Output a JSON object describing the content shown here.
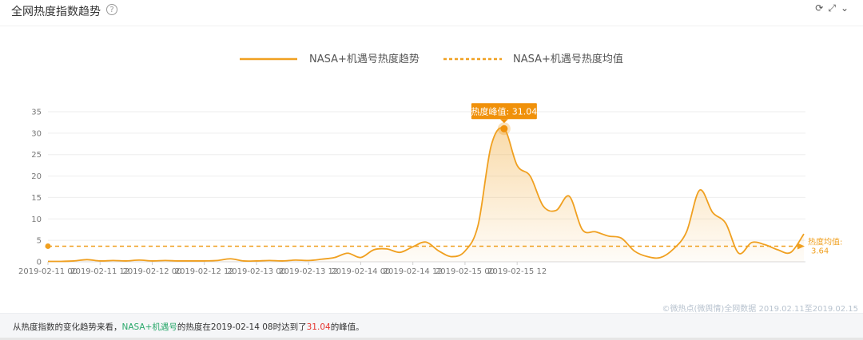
{
  "header": {
    "title": "全网热度指数趋势",
    "help_icon": "question-circle-icon",
    "toolbar_icons": [
      "refresh-icon",
      "expand-icon",
      "chevron-down-icon"
    ]
  },
  "colors": {
    "series": "#f0a020",
    "average": "#f0a020",
    "peak_badge": "#f0910a",
    "keyword": "#2aa86b",
    "peak_value": "#e5342f"
  },
  "chart_data": {
    "type": "area",
    "legend_position": "top-center",
    "grid": true,
    "ylim": [
      0,
      35
    ],
    "yticks": [
      0,
      5,
      10,
      15,
      20,
      25,
      30,
      35
    ],
    "x_start": "2019-02-11 00",
    "x_end": "2019-02-15 21",
    "x_step_hours": 3,
    "xtick_labels": [
      "2019-02-11 00",
      "2019-02-11 12",
      "2019-02-12 00",
      "2019-02-12 12",
      "2019-02-13 00",
      "2019-02-13 12",
      "2019-02-14 00",
      "2019-02-14 12",
      "2019-02-15 00",
      "2019-02-15 12"
    ],
    "series": [
      {
        "name": "NASA+机遇号热度趋势",
        "style": "solid",
        "values": [
          0.1,
          0.1,
          0.2,
          0.5,
          0.2,
          0.3,
          0.2,
          0.4,
          0.2,
          0.3,
          0.2,
          0.2,
          0.2,
          0.3,
          0.7,
          0.2,
          0.2,
          0.3,
          0.2,
          0.4,
          0.3,
          0.6,
          1.0,
          2.0,
          1.0,
          2.8,
          3.0,
          2.2,
          3.5,
          4.6,
          2.5,
          1.2,
          2.5,
          8.5,
          27.0,
          31.04,
          22.5,
          20.0,
          13.0,
          12.0,
          15.3,
          7.5,
          7.0,
          6.0,
          5.5,
          2.5,
          1.2,
          1.0,
          3.0,
          7.0,
          16.7,
          11.5,
          9.0,
          2.0,
          4.5,
          4.0,
          2.8,
          2.2,
          6.5
        ]
      },
      {
        "name": "NASA+机遇号热度均值",
        "style": "dashed",
        "value": 3.64
      }
    ],
    "peak": {
      "label": "热度峰值: 31.04",
      "value": 31.04
    },
    "average_label": {
      "title": "热度均值:",
      "value": "3.64"
    }
  },
  "source": "©微热点(微舆情)全网数据 2019.02.11至2019.02.15",
  "summary": {
    "prefix": "从热度指数的变化趋势来看，",
    "keyword": "NASA+机遇号",
    "middle": "的热度在2019-02-14 08时达到了",
    "peak_value": "31.04",
    "suffix": "的峰值。"
  }
}
